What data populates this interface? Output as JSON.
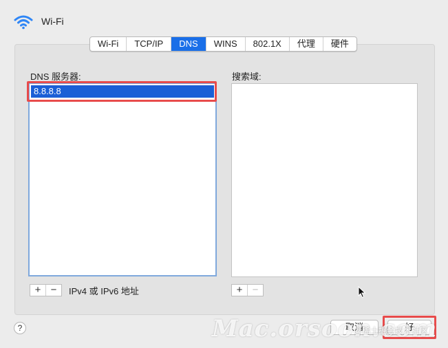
{
  "header": {
    "title": "Wi-Fi",
    "icon": "wifi-icon"
  },
  "tabs": [
    {
      "label": "Wi-Fi",
      "active": false
    },
    {
      "label": "TCP/IP",
      "active": false
    },
    {
      "label": "DNS",
      "active": true
    },
    {
      "label": "WINS",
      "active": false
    },
    {
      "label": "802.1X",
      "active": false
    },
    {
      "label": "代理",
      "active": false
    },
    {
      "label": "硬件",
      "active": false
    }
  ],
  "dns": {
    "label": "DNS 服务器:",
    "servers": [
      "8.8.8.8"
    ],
    "hint": "IPv4 或 IPv6 地址"
  },
  "search_domains": {
    "label": "搜索域:",
    "items": []
  },
  "controls": {
    "add": "+",
    "remove": "−"
  },
  "buttons": {
    "help": "?",
    "cancel": "取消",
    "ok": "好"
  },
  "watermark": {
    "main": "Mac.orsoon.com",
    "sub": "@稀土掘金技术社区"
  },
  "colors": {
    "accent": "#1a6fe8",
    "selection": "#1b5fd6",
    "highlight": "#e84b4b"
  }
}
